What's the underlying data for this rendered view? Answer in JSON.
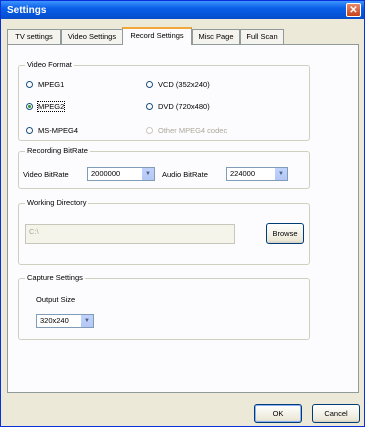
{
  "window": {
    "title": "Settings",
    "close_glyph": "✕"
  },
  "tabs": [
    {
      "label": "TV settings"
    },
    {
      "label": "Video Settings"
    },
    {
      "label": "Record Settings",
      "active": true
    },
    {
      "label": "Misc Page"
    },
    {
      "label": "Full Scan"
    }
  ],
  "video_format": {
    "title": "Video Format",
    "options": [
      {
        "label": "MPEG1",
        "checked": false,
        "enabled": true
      },
      {
        "label": "VCD (352x240)",
        "checked": false,
        "enabled": true
      },
      {
        "label": "MPEG2",
        "checked": true,
        "enabled": true
      },
      {
        "label": "DVD (720x480)",
        "checked": false,
        "enabled": true
      },
      {
        "label": "MS-MPEG4",
        "checked": false,
        "enabled": true
      },
      {
        "label": "Other MPEG4 codec",
        "checked": false,
        "enabled": false
      }
    ]
  },
  "bitrate": {
    "title": "Recording BitRate",
    "video_label": "Video BitRate",
    "video_value": "2000000",
    "audio_label": "Audio BitRate",
    "audio_value": "224000"
  },
  "working_dir": {
    "title": "Working Directory",
    "value": "C:\\",
    "browse_label": "Browse"
  },
  "capture": {
    "title": "Capture Settings",
    "output_size_label": "Output Size",
    "output_size_value": "320x240"
  },
  "footer": {
    "ok_label": "OK",
    "cancel_label": "Cancel"
  },
  "icons": {
    "dropdown": "chevron-down-icon",
    "close": "close-icon"
  },
  "colors": {
    "title_bar": "#0553d6",
    "dialog_bg": "#ece9d8",
    "panel_bg": "#fcfcfe",
    "close_button": "#c4431b",
    "radio_check": "#2a9b2a"
  }
}
